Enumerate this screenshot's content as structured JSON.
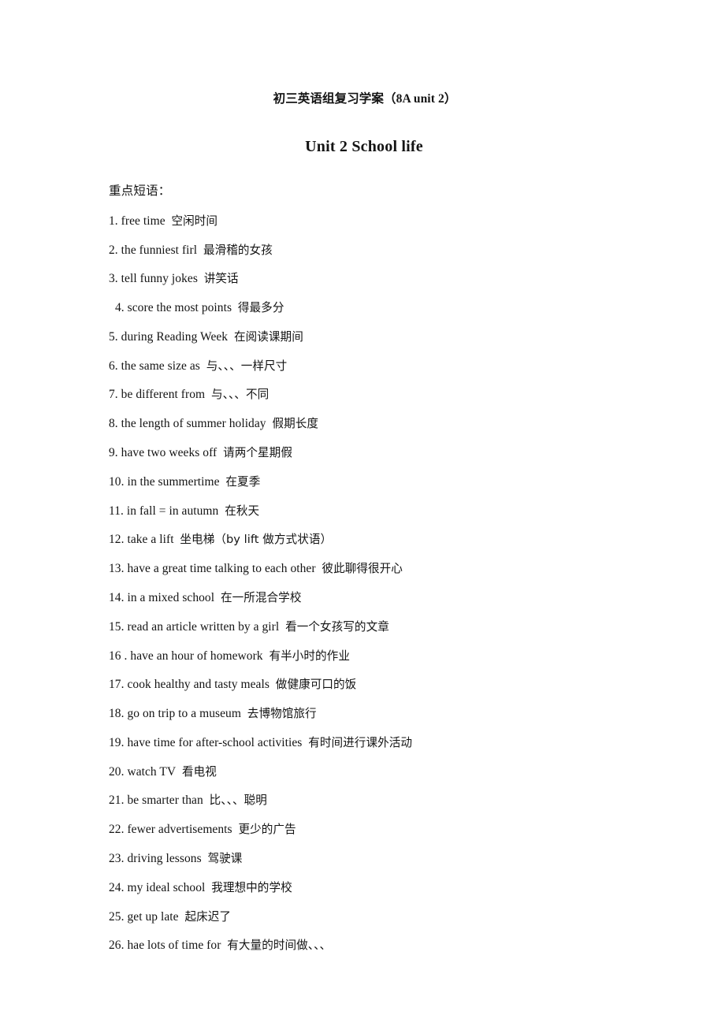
{
  "document": {
    "header_line": "初三英语组复习学案（8A unit 2）",
    "title": "Unit 2 School life",
    "section_label": "重点短语：",
    "page_background": "#ffffff",
    "text_color": "#141414"
  },
  "phrases": [
    {
      "num": "1.",
      "en": "free time",
      "zh": "空闲时间",
      "indent": false
    },
    {
      "num": "2.",
      "en": "the funniest firl",
      "zh": "最滑稽的女孩",
      "indent": false
    },
    {
      "num": "3.",
      "en": "tell funny jokes",
      "zh": "讲笑话",
      "indent": false
    },
    {
      "num": "4.",
      "en": "score the most points",
      "zh": "得最多分",
      "indent": true
    },
    {
      "num": "5.",
      "en": "during Reading Week",
      "zh": "在阅读课期间",
      "indent": false
    },
    {
      "num": "6.",
      "en": "the same size as",
      "zh": "与、、、一样尺寸",
      "indent": false
    },
    {
      "num": "7.",
      "en": "be different from",
      "zh": "与、、、不同",
      "indent": false
    },
    {
      "num": "8.",
      "en": "the length of summer holiday",
      "zh": "假期长度",
      "indent": false
    },
    {
      "num": "9.",
      "en": "have two weeks off",
      "zh": "请两个星期假",
      "indent": false
    },
    {
      "num": "10.",
      "en": "in the summertime",
      "zh": "在夏季",
      "indent": false
    },
    {
      "num": "11.",
      "en": "in fall = in autumn",
      "zh": "在秋天",
      "indent": false
    },
    {
      "num": "12.",
      "en": "take a lift",
      "zh": "坐电梯（by lift 做方式状语）",
      "indent": false
    },
    {
      "num": "13.",
      "en": "have a great time talking to each other",
      "zh": "彼此聊得很开心",
      "indent": false
    },
    {
      "num": "14.",
      "en": "in a mixed school",
      "zh": "在一所混合学校",
      "indent": false
    },
    {
      "num": "15.",
      "en": "read an article written by a girl",
      "zh": "看一个女孩写的文章",
      "indent": false
    },
    {
      "num": "16 .",
      "en": "have an hour of homework",
      "zh": "有半小时的作业",
      "indent": false
    },
    {
      "num": "17.",
      "en": "cook healthy and tasty meals",
      "zh": "做健康可口的饭",
      "indent": false
    },
    {
      "num": "18.",
      "en": "go on trip to a museum",
      "zh": "去博物馆旅行",
      "indent": false
    },
    {
      "num": "19.",
      "en": "have time for after-school activities",
      "zh": "有时间进行课外活动",
      "indent": false
    },
    {
      "num": "20.",
      "en": "watch TV",
      "zh": "看电视",
      "indent": false
    },
    {
      "num": "21.",
      "en": "be smarter than",
      "zh": "比、、、聪明",
      "indent": false
    },
    {
      "num": "22.",
      "en": "fewer advertisements",
      "zh": "更少的广告",
      "indent": false
    },
    {
      "num": "23.",
      "en": "driving lessons",
      "zh": "驾驶课",
      "indent": false
    },
    {
      "num": "24.",
      "en": "my ideal school",
      "zh": "我理想中的学校",
      "indent": false
    },
    {
      "num": "25.",
      "en": "get up late",
      "zh": "起床迟了",
      "indent": false
    },
    {
      "num": "26.",
      "en": "hae lots of time for",
      "zh": "有大量的时间做、、、",
      "indent": false
    }
  ]
}
